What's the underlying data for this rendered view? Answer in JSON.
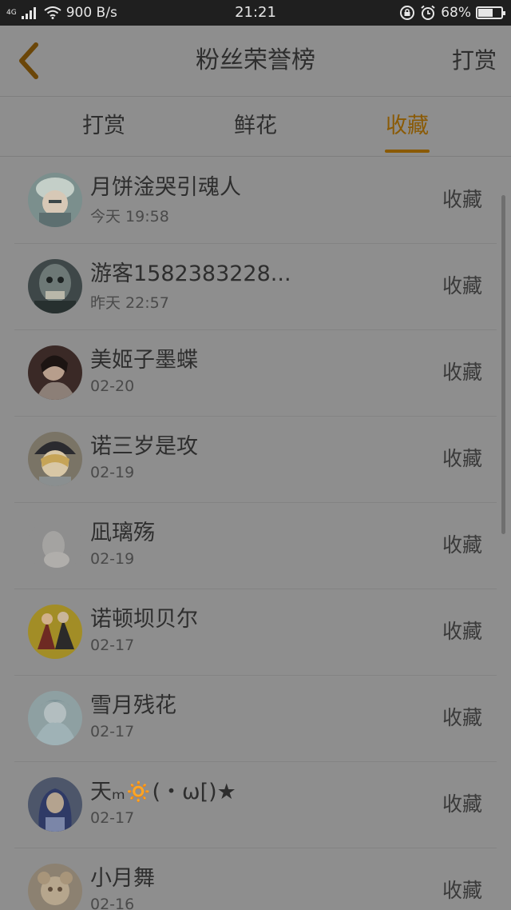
{
  "status_bar": {
    "network_label": "4G",
    "speed": "900 B/s",
    "time": "21:21",
    "battery": "68%",
    "battery_level": 0.68
  },
  "header": {
    "back_icon": "chevron-left-icon",
    "title": "粉丝荣誉榜",
    "action_label": "打赏"
  },
  "tabs": [
    {
      "label": "打赏",
      "active": false
    },
    {
      "label": "鲜花",
      "active": false
    },
    {
      "label": "收藏",
      "active": true
    }
  ],
  "colors": {
    "accent": "#8a5a05",
    "overlay": "#8e8e8e",
    "status_bar": "#1f1f1f"
  },
  "list": [
    {
      "name": "月饼淦哭引魂人",
      "time": "今天 19:58",
      "action": "收藏"
    },
    {
      "name": "游客1582383228...",
      "time": "昨天 22:57",
      "action": "收藏"
    },
    {
      "name": "美姬子墨蝶",
      "time": "02-20",
      "action": "收藏"
    },
    {
      "name": "诺三岁是攻",
      "time": "02-19",
      "action": "收藏"
    },
    {
      "name": "凪璃殇",
      "time": "02-19",
      "action": "收藏"
    },
    {
      "name": "诺顿坝贝尔",
      "time": "02-17",
      "action": "收藏"
    },
    {
      "name": "雪月残花",
      "time": "02-17",
      "action": "收藏"
    },
    {
      "name": "天ₘ🔅(・ω[)★",
      "time": "02-17",
      "action": "收藏"
    },
    {
      "name": "小月舞",
      "time": "02-16",
      "action": "收藏"
    }
  ]
}
